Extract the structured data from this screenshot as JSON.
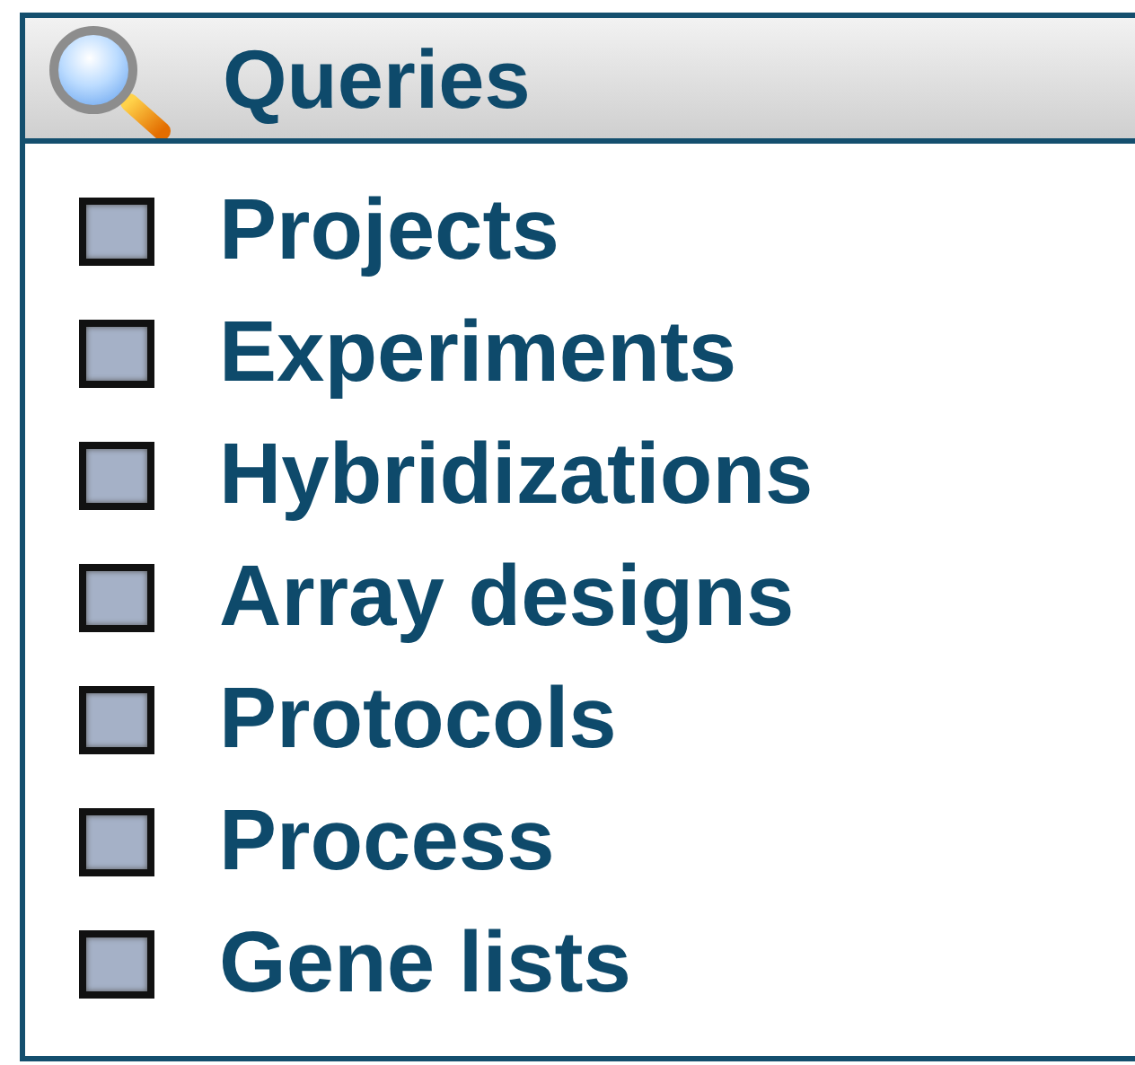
{
  "panel": {
    "title": "Queries",
    "items": [
      {
        "label": "Projects"
      },
      {
        "label": "Experiments"
      },
      {
        "label": "Hybridizations"
      },
      {
        "label": "Array designs"
      },
      {
        "label": "Protocols"
      },
      {
        "label": "Process"
      },
      {
        "label": "Gene lists"
      }
    ]
  }
}
